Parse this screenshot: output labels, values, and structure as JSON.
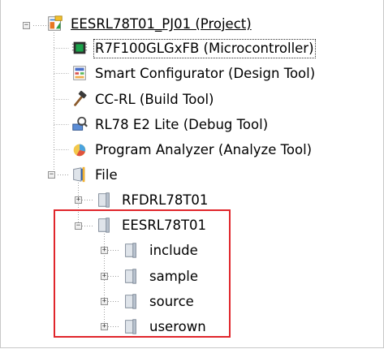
{
  "colors": {
    "highlight": "#e0262b",
    "tree_line": "#a0a0a0",
    "folder_face": "#dfe4ea"
  },
  "tree": {
    "project": {
      "label": "EESRL78T01_PJ01 (Project)",
      "expander": "−",
      "icon": "project-icon"
    },
    "children": [
      {
        "label": "R7F100GLGxFB (Microcontroller)",
        "icon": "microcontroller-icon"
      },
      {
        "label": "Smart Configurator (Design Tool)",
        "icon": "smart-configurator-icon"
      },
      {
        "label": "CC-RL (Build Tool)",
        "icon": "hammer-icon"
      },
      {
        "label": "RL78 E2 Lite (Debug Tool)",
        "icon": "debug-tool-icon"
      },
      {
        "label": "Program Analyzer (Analyze Tool)",
        "icon": "analyzer-icon"
      }
    ],
    "file": {
      "label": "File",
      "expander": "−",
      "icon": "file-folder-icon",
      "items": [
        {
          "label": "RFDRL78T01",
          "expander": "+",
          "icon": "folder-icon"
        },
        {
          "label": "EESRL78T01",
          "expander": "−",
          "icon": "folder-icon",
          "items": [
            {
              "label": "include",
              "expander": "+",
              "icon": "folder-icon"
            },
            {
              "label": "sample",
              "expander": "+",
              "icon": "folder-icon"
            },
            {
              "label": "source",
              "expander": "+",
              "icon": "folder-icon"
            },
            {
              "label": "userown",
              "expander": "+",
              "icon": "folder-icon"
            }
          ]
        }
      ]
    }
  }
}
